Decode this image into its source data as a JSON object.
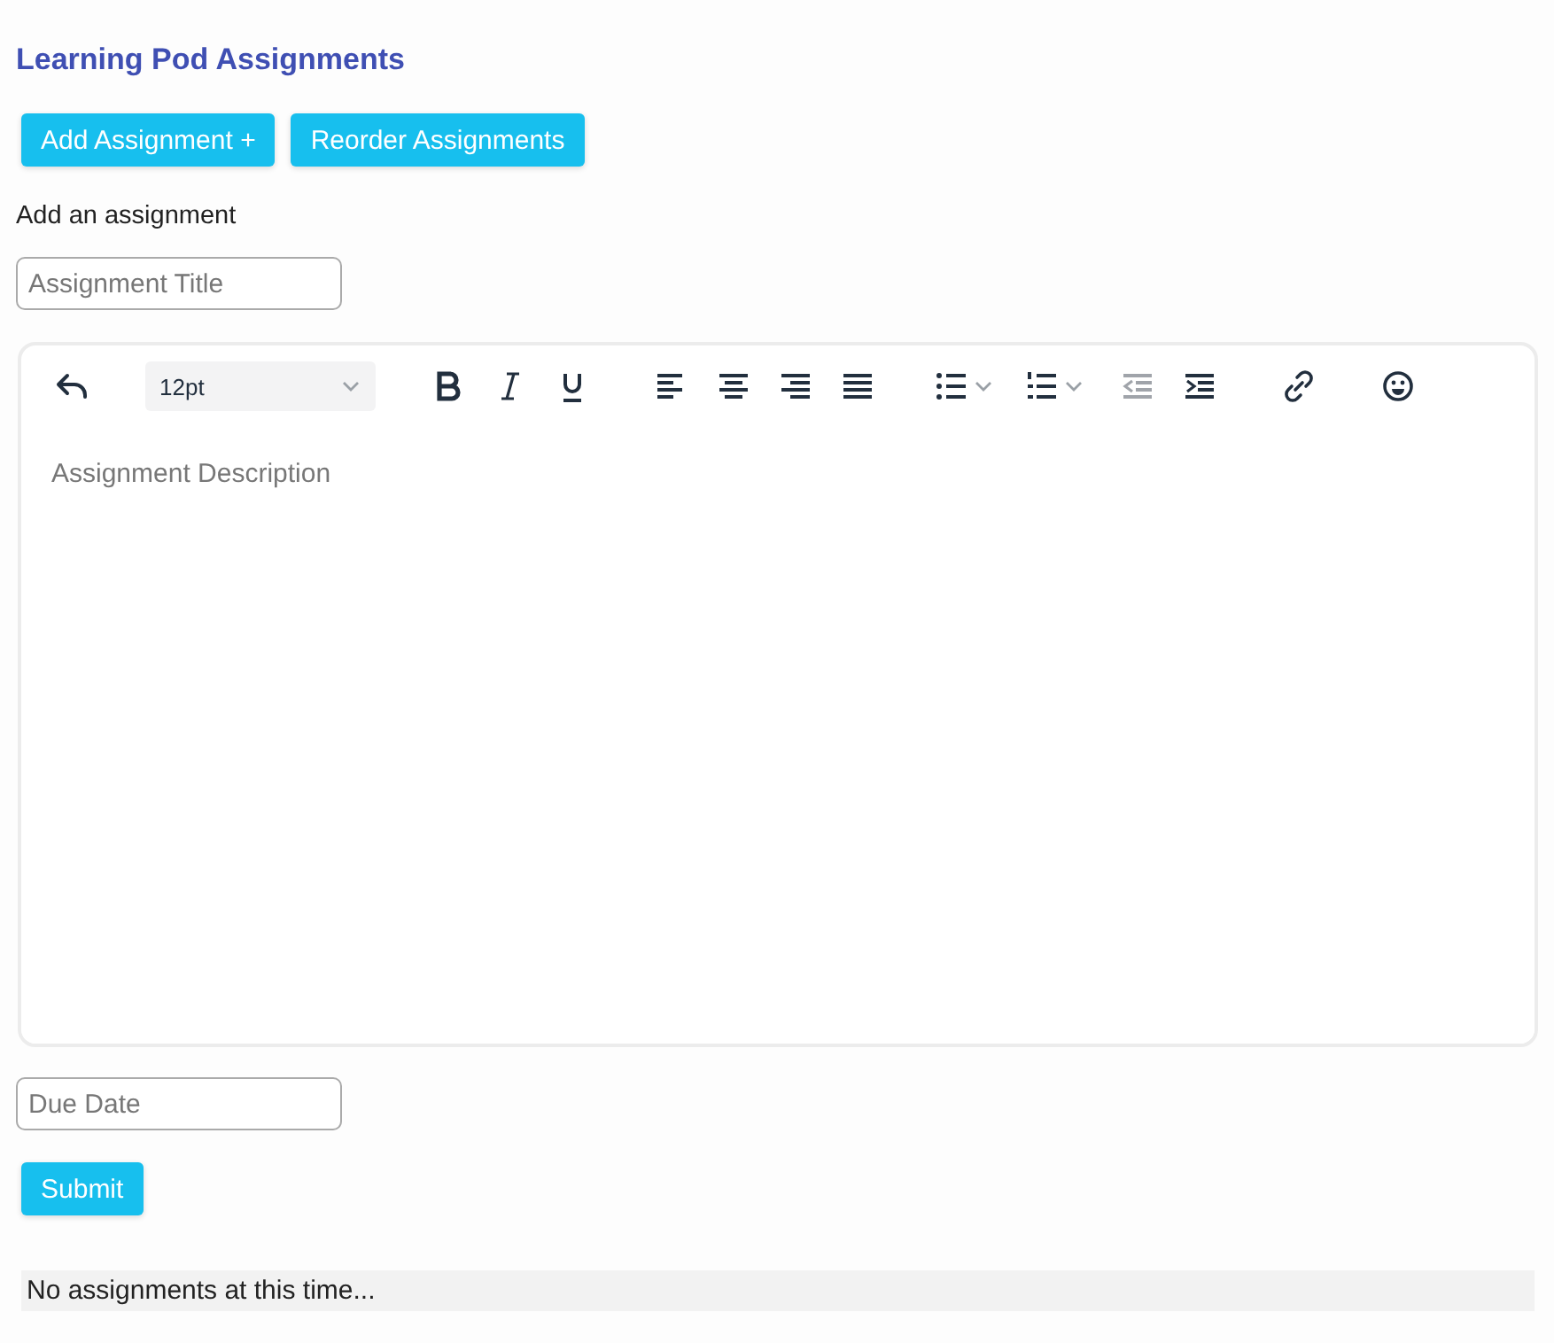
{
  "title": "Learning Pod Assignments",
  "actions": [
    {
      "label": "Add Assignment +"
    },
    {
      "label": "Reorder Assignments"
    }
  ],
  "form_heading": "Add an assignment",
  "title_field": {
    "placeholder": "Assignment Title"
  },
  "editor": {
    "toolbar": [
      [
        {
          "kind": "undo",
          "disabled": false
        }
      ],
      [
        {
          "kind": "font-size",
          "value": "12pt"
        }
      ],
      [
        {
          "kind": "bold",
          "disabled": false
        },
        {
          "kind": "italic",
          "disabled": false
        },
        {
          "kind": "underline",
          "disabled": false
        }
      ],
      [
        {
          "kind": "align-left",
          "disabled": false
        },
        {
          "kind": "align-center",
          "disabled": false
        },
        {
          "kind": "align-right",
          "disabled": false
        },
        {
          "kind": "justify",
          "disabled": false
        }
      ],
      [
        {
          "kind": "bullet-list",
          "disabled": false
        },
        {
          "kind": "numbered-list",
          "disabled": false
        },
        {
          "kind": "outdent",
          "disabled": true
        },
        {
          "kind": "indent",
          "disabled": false
        }
      ],
      [
        {
          "kind": "link",
          "disabled": false
        }
      ],
      [
        {
          "kind": "emoji",
          "disabled": false
        }
      ]
    ],
    "placeholder": "Assignment Description"
  },
  "due_field": {
    "placeholder": "Due Date"
  },
  "submit": "Submit",
  "empty_message": "No assignments at this time..."
}
